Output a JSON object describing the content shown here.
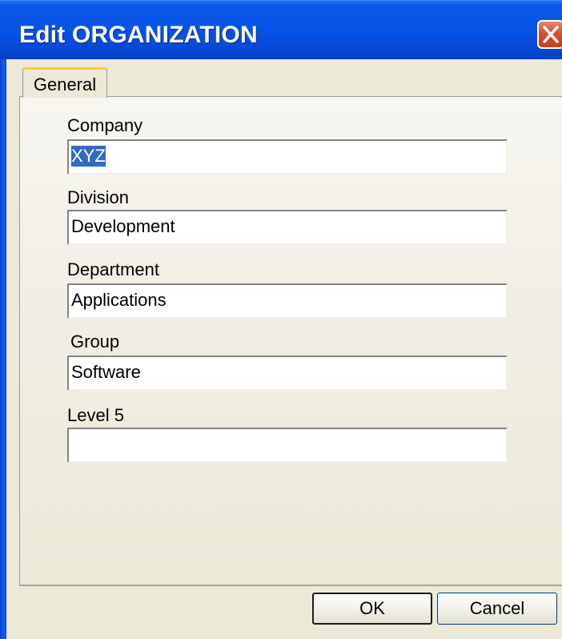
{
  "window": {
    "title": "Edit ORGANIZATION"
  },
  "tabs": [
    {
      "label": "General",
      "active": true
    }
  ],
  "fields": [
    {
      "label": "Company",
      "value": "XYZ",
      "selected": true
    },
    {
      "label": "Division",
      "value": "Development"
    },
    {
      "label": "Department",
      "value": "Applications"
    },
    {
      "label": "Group",
      "value": "Software"
    },
    {
      "label": "Level 5",
      "value": ""
    }
  ],
  "buttons": {
    "ok_label": "OK",
    "cancel_label": "Cancel"
  },
  "colors": {
    "title_bar": "#0753e6",
    "dialog_face": "#ece9d8",
    "selection": "#316ac5",
    "close_button": "#d8512f"
  }
}
